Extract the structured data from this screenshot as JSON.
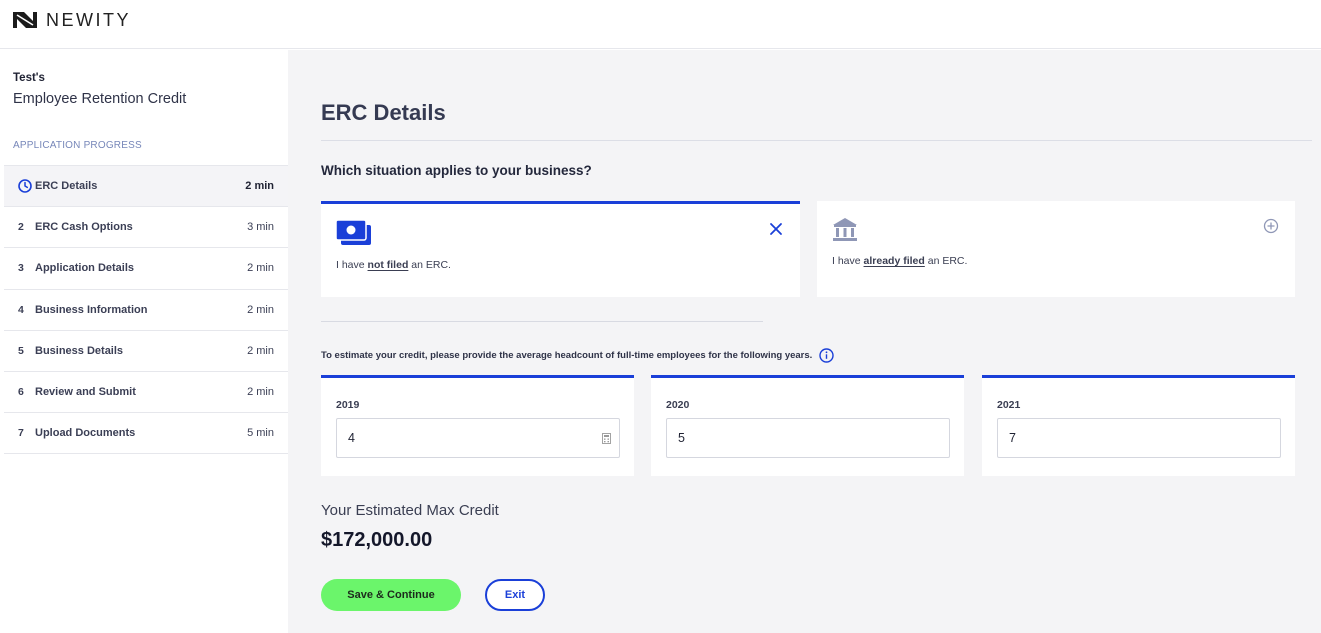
{
  "brand": {
    "name": "NEWITY",
    "icon": "newity-logo-icon"
  },
  "sidebar": {
    "owner": "Test's",
    "title": "Employee Retention Credit",
    "progress_heading": "APPLICATION PROGRESS",
    "steps": [
      {
        "num": "",
        "icon": "clock-icon",
        "label": "ERC Details",
        "time": "2 min",
        "active": true
      },
      {
        "num": "2",
        "label": "ERC Cash Options",
        "time": "3 min"
      },
      {
        "num": "3",
        "label": "Application Details",
        "time": "2 min"
      },
      {
        "num": "4",
        "label": "Business Information",
        "time": "2 min"
      },
      {
        "num": "5",
        "label": "Business Details",
        "time": "2 min"
      },
      {
        "num": "6",
        "label": "Review and Submit",
        "time": "2 min"
      },
      {
        "num": "7",
        "label": "Upload Documents",
        "time": "5 min"
      }
    ]
  },
  "main": {
    "title": "ERC Details",
    "question": "Which situation applies to your business?",
    "options": [
      {
        "icon": "cash-icon",
        "pre": "I have ",
        "emph": "not filed",
        "post": " an ERC.",
        "action_icon": "close-icon",
        "selected": true
      },
      {
        "icon": "bank-icon",
        "pre": "I have ",
        "emph": "already filed",
        "post": " an ERC.",
        "action_icon": "plus-circle-icon",
        "selected": false
      }
    ],
    "estimate_prompt": "To estimate your credit, please provide the average headcount of full-time employees for the following years.",
    "years": [
      {
        "label": "2019",
        "value": "4"
      },
      {
        "label": "2020",
        "value": "5"
      },
      {
        "label": "2021",
        "value": "7"
      }
    ],
    "max_credit_label": "Your Estimated Max Credit",
    "max_credit_value": "$172,000.00",
    "save_label": "Save & Continue",
    "exit_label": "Exit"
  },
  "colors": {
    "accent": "#1a3fd8",
    "save": "#6bf56b",
    "background": "#f4f4f6"
  }
}
